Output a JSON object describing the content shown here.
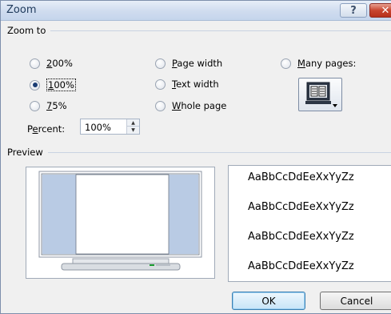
{
  "window": {
    "title": "Zoom",
    "help_label": "?",
    "close_label": "✕"
  },
  "zoom_to": {
    "label": "Zoom to",
    "options": [
      {
        "label": "200%",
        "mnemonic": "2",
        "rest": "00%",
        "checked": false
      },
      {
        "label": "100%",
        "mnemonic": "1",
        "rest": "00%",
        "checked": true
      },
      {
        "label": "75%",
        "mnemonic": "7",
        "rest": "5%",
        "checked": false
      },
      {
        "label": "Page width",
        "mnemonic": "P",
        "rest": "age width",
        "checked": false
      },
      {
        "label": "Text width",
        "mnemonic": "T",
        "rest": "ext width",
        "checked": false
      },
      {
        "label": "Whole page",
        "mnemonic": "W",
        "rest": "hole page",
        "checked": false
      },
      {
        "label": "Many pages:",
        "mnemonic": "M",
        "rest": "any pages:",
        "checked": false
      }
    ],
    "percent_label_pre": "P",
    "percent_label_mn": "e",
    "percent_label_post": "rcent:",
    "percent_value": "100%"
  },
  "preview": {
    "label": "Preview",
    "sample_lines": [
      "AaBbCcDdEeXxYyZz",
      "AaBbCcDdEeXxYyZz",
      "AaBbCcDdEeXxYyZz",
      "AaBbCcDdEeXxYyZz"
    ]
  },
  "buttons": {
    "ok": "OK",
    "cancel": "Cancel"
  },
  "colors": {
    "screen_side": "#b9cbe4",
    "selected_dot": "#1b3d74"
  }
}
